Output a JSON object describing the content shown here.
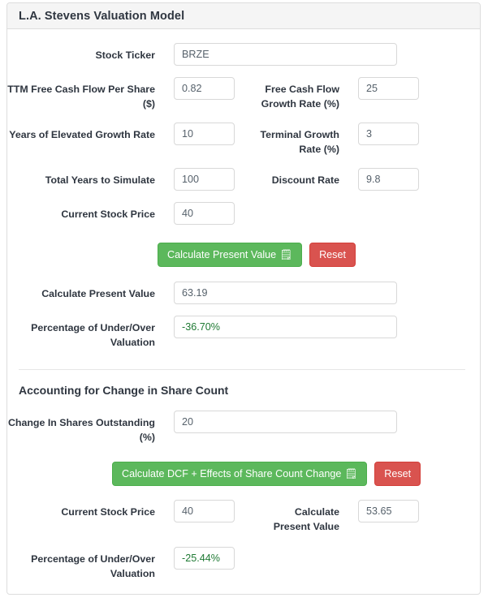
{
  "card": {
    "title": "L.A. Stevens Valuation Model"
  },
  "colors": {
    "accent_green": "#5cb85c",
    "accent_red": "#d9534f",
    "header_bg": "#f5f5f5",
    "positive_text": "#1f7a34",
    "border": "#dddddd"
  },
  "form": {
    "stock_ticker": {
      "label": "Stock Ticker",
      "value": "BRZE"
    },
    "ttm_fcf_per_share": {
      "label": "TTM Free Cash Flow Per Share ($)",
      "value": "0.82"
    },
    "fcf_growth_rate": {
      "label": "Free Cash Flow Growth Rate (%)",
      "value": "25"
    },
    "years_elevated_growth": {
      "label": "Years of Elevated Growth Rate",
      "value": "10"
    },
    "terminal_growth_rate": {
      "label": "Terminal Growth Rate (%)",
      "value": "3"
    },
    "total_years_simulate": {
      "label": "Total Years to Simulate",
      "value": "100"
    },
    "discount_rate": {
      "label": "Discount Rate",
      "value": "9.8"
    },
    "current_stock_price": {
      "label": "Current Stock Price",
      "value": "40"
    }
  },
  "actions": {
    "calculate_present_value": {
      "label": "Calculate Present Value",
      "icon": "calculator-icon",
      "glyph": "🗒"
    },
    "reset": {
      "label": "Reset"
    },
    "calculate_dcf_share_count": {
      "label": "Calculate DCF + Effects of Share Count Change",
      "icon": "calculator-icon",
      "glyph": "🗒"
    },
    "reset_2": {
      "label": "Reset"
    }
  },
  "results": {
    "present_value": {
      "label": "Calculate Present Value",
      "value": "63.19"
    },
    "under_over_valuation": {
      "label": "Percentage of Under/Over Valuation",
      "value": "-36.70%"
    }
  },
  "share_count_section": {
    "heading": "Accounting for Change in Share Count",
    "change_in_shares": {
      "label": "Change In Shares Outstanding (%)",
      "value": "20"
    },
    "current_stock_price": {
      "label": "Current Stock Price",
      "value": "40"
    },
    "present_value": {
      "label": "Calculate Present Value",
      "value": "53.65"
    },
    "under_over_valuation": {
      "label": "Percentage of Under/Over Valuation",
      "value": "-25.44%"
    }
  }
}
